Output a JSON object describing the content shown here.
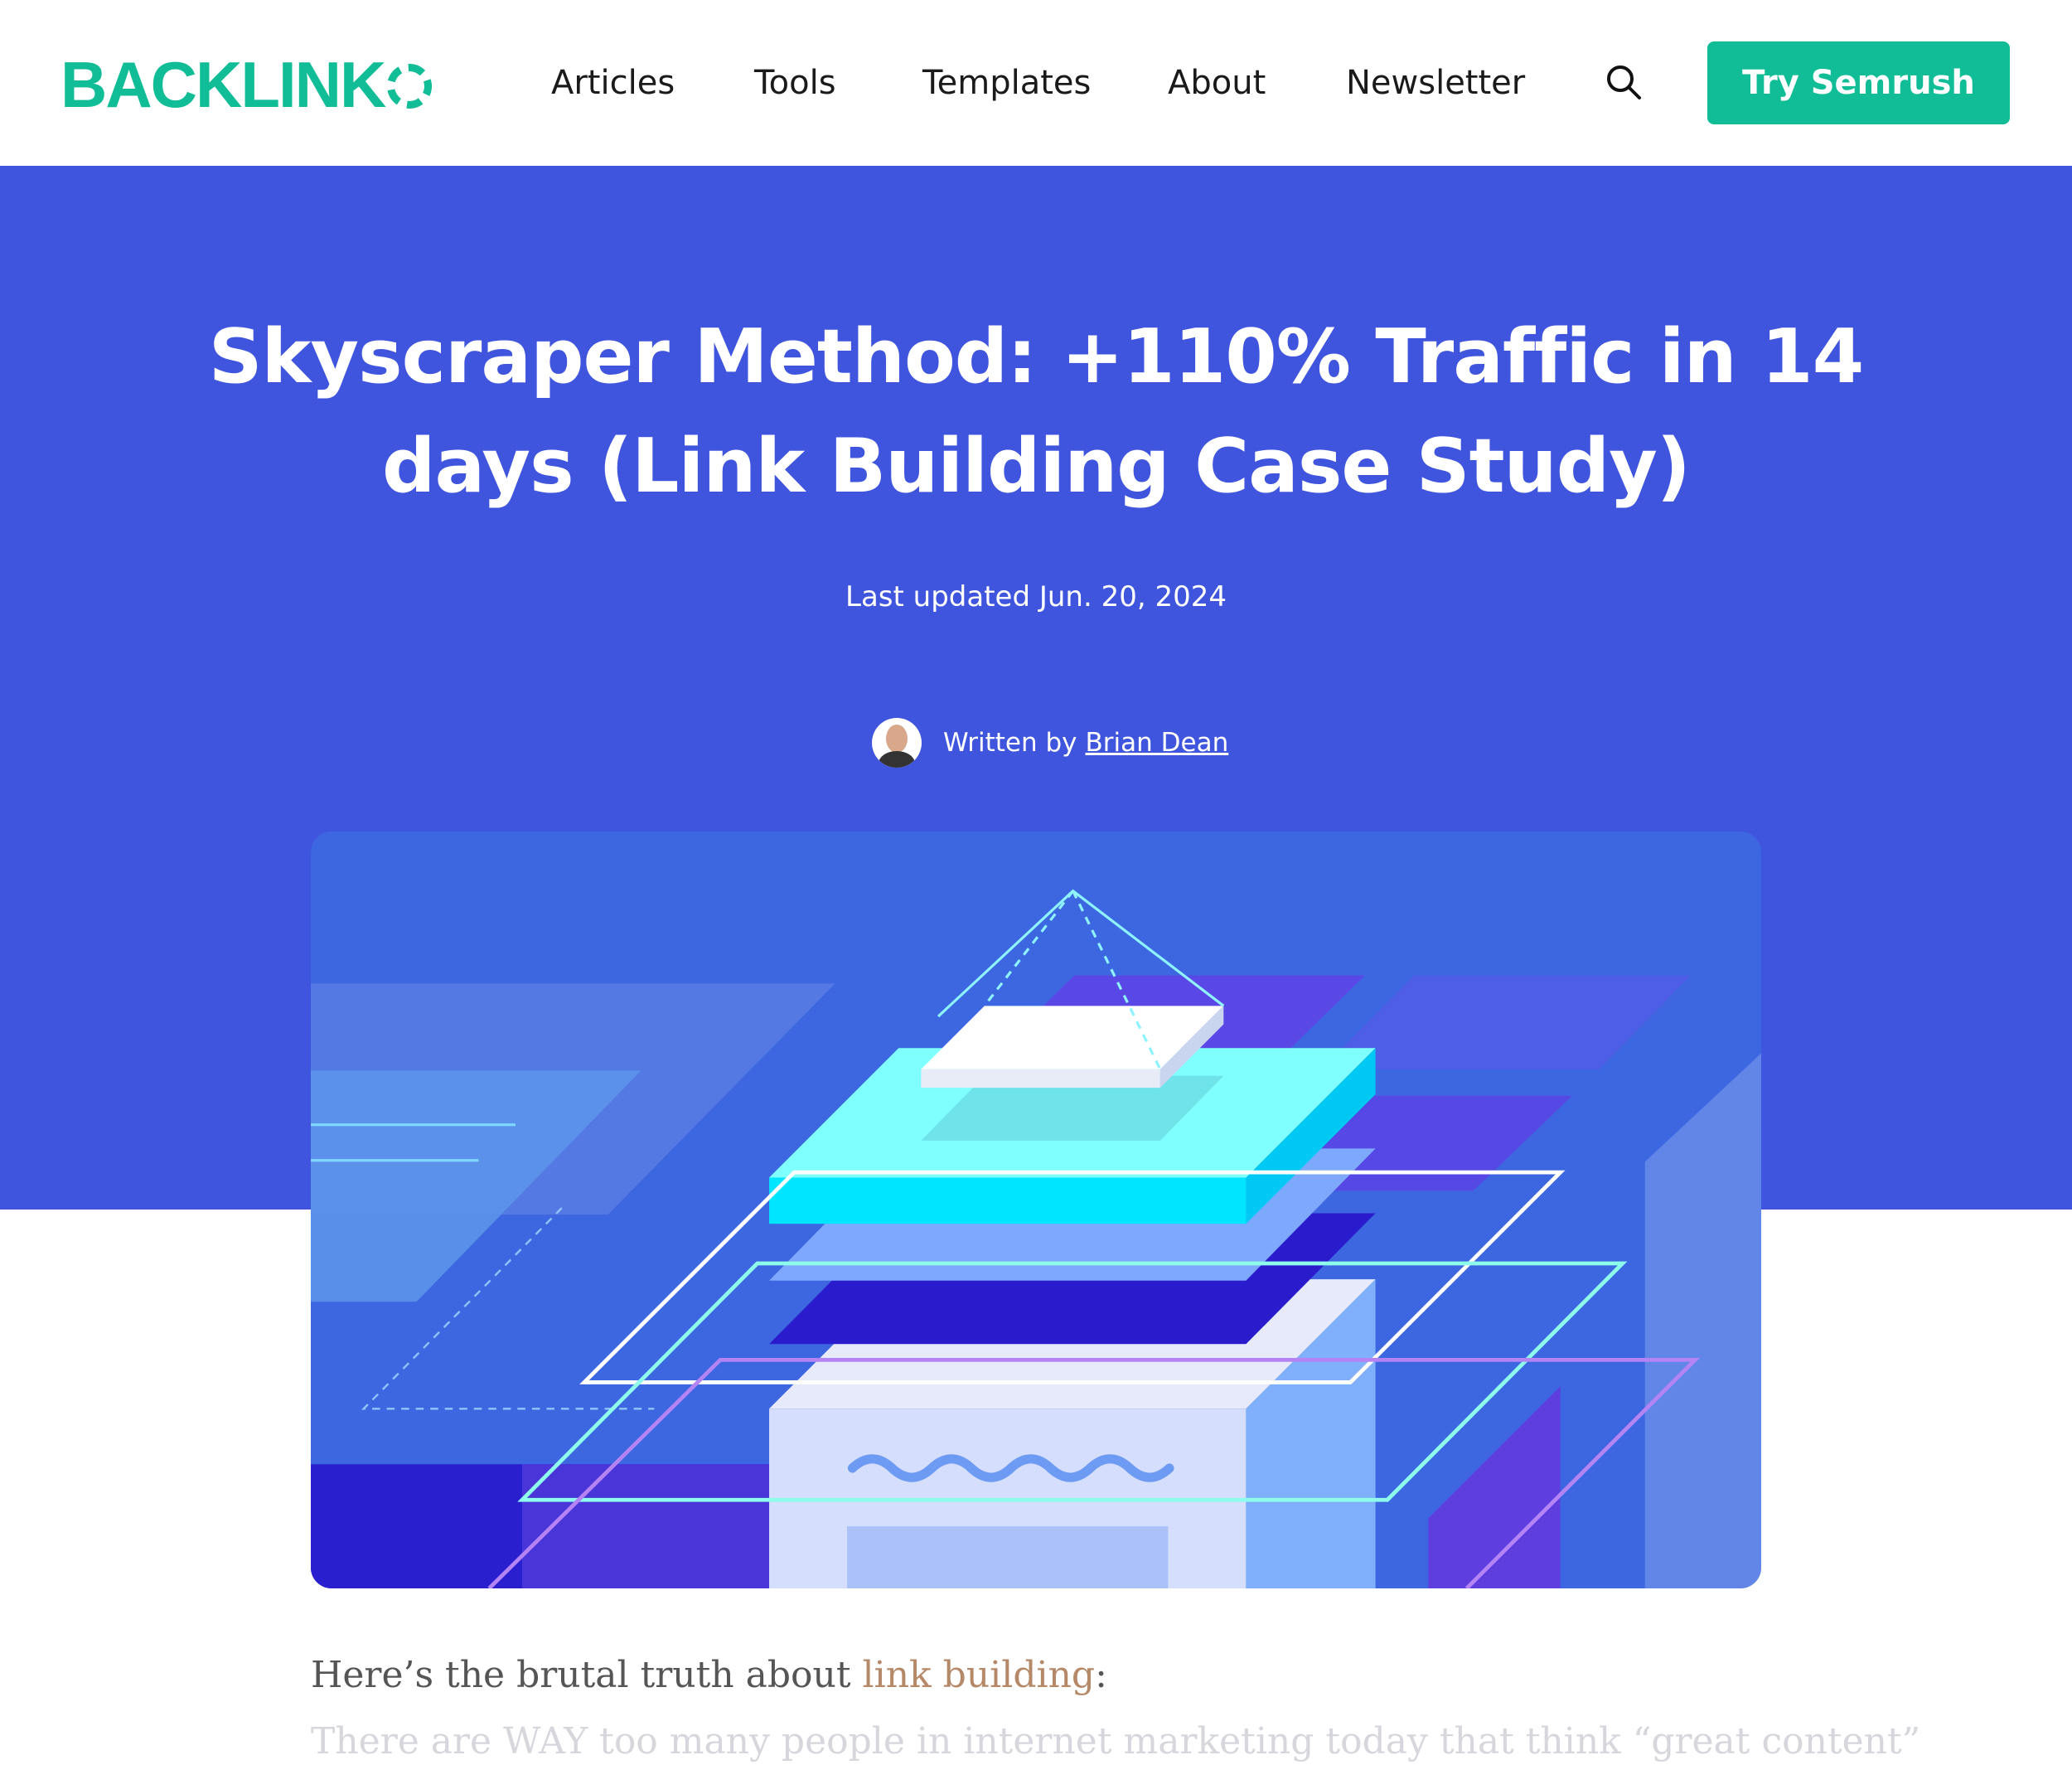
{
  "header": {
    "logo": "BACKLINK",
    "nav": [
      "Articles",
      "Tools",
      "Templates",
      "About",
      "Newsletter"
    ],
    "search_icon": "search-icon",
    "cta_label": "Try Semrush",
    "brand_color": "#10bd97"
  },
  "hero": {
    "title": "Skyscraper Method: +110% Traffic in 14 days (Link Building Case Study)",
    "updated": "Last updated Jun. 20, 2024",
    "written_by": "Written by",
    "author": "Brian Dean",
    "band_color": "#3f55dd"
  },
  "article": {
    "intro_prefix": "Here’s the brutal truth about ",
    "intro_link": "link building",
    "intro_suffix": ":",
    "line2": "There are WAY too many people in internet marketing today that think “great content”"
  }
}
